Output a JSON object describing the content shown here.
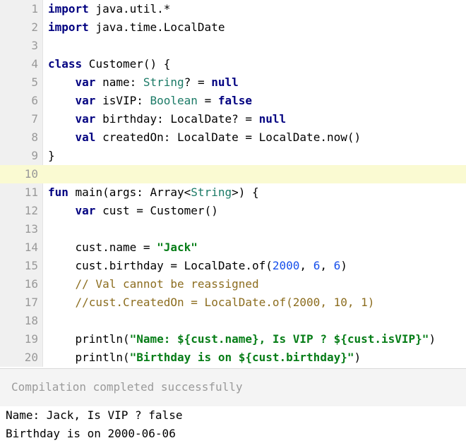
{
  "editor": {
    "lines": [
      {
        "num": "1",
        "tokens": [
          {
            "t": "import",
            "c": "kw"
          },
          {
            "t": " java.util.*",
            "c": ""
          }
        ]
      },
      {
        "num": "2",
        "tokens": [
          {
            "t": "import",
            "c": "kw"
          },
          {
            "t": " java.time.LocalDate",
            "c": ""
          }
        ]
      },
      {
        "num": "3",
        "tokens": []
      },
      {
        "num": "4",
        "tokens": [
          {
            "t": "class",
            "c": "kw"
          },
          {
            "t": " Customer() {",
            "c": ""
          }
        ]
      },
      {
        "num": "5",
        "tokens": [
          {
            "t": "    ",
            "c": ""
          },
          {
            "t": "var",
            "c": "kw"
          },
          {
            "t": " name: ",
            "c": ""
          },
          {
            "t": "String",
            "c": "ty"
          },
          {
            "t": "? = ",
            "c": ""
          },
          {
            "t": "null",
            "c": "kw"
          }
        ]
      },
      {
        "num": "6",
        "tokens": [
          {
            "t": "    ",
            "c": ""
          },
          {
            "t": "var",
            "c": "kw"
          },
          {
            "t": " isVIP: ",
            "c": ""
          },
          {
            "t": "Boolean",
            "c": "ty"
          },
          {
            "t": " = ",
            "c": ""
          },
          {
            "t": "false",
            "c": "kw"
          }
        ]
      },
      {
        "num": "7",
        "tokens": [
          {
            "t": "    ",
            "c": ""
          },
          {
            "t": "var",
            "c": "kw"
          },
          {
            "t": " birthday: LocalDate? = ",
            "c": ""
          },
          {
            "t": "null",
            "c": "kw"
          }
        ]
      },
      {
        "num": "8",
        "tokens": [
          {
            "t": "    ",
            "c": ""
          },
          {
            "t": "val",
            "c": "kw"
          },
          {
            "t": " createdOn: LocalDate = LocalDate.now()",
            "c": ""
          }
        ]
      },
      {
        "num": "9",
        "tokens": [
          {
            "t": "}",
            "c": ""
          }
        ]
      },
      {
        "num": "10",
        "tokens": [],
        "highlight": true
      },
      {
        "num": "11",
        "tokens": [
          {
            "t": "fun",
            "c": "kw"
          },
          {
            "t": " main(args: Array<",
            "c": ""
          },
          {
            "t": "String",
            "c": "ty"
          },
          {
            "t": ">) {",
            "c": ""
          }
        ]
      },
      {
        "num": "12",
        "tokens": [
          {
            "t": "    ",
            "c": ""
          },
          {
            "t": "var",
            "c": "kw"
          },
          {
            "t": " cust = Customer()",
            "c": ""
          }
        ]
      },
      {
        "num": "13",
        "tokens": []
      },
      {
        "num": "14",
        "tokens": [
          {
            "t": "    cust.name = ",
            "c": ""
          },
          {
            "t": "\"Jack\"",
            "c": "str"
          }
        ]
      },
      {
        "num": "15",
        "tokens": [
          {
            "t": "    cust.birthday = LocalDate.of(",
            "c": ""
          },
          {
            "t": "2000",
            "c": "num"
          },
          {
            "t": ", ",
            "c": ""
          },
          {
            "t": "6",
            "c": "num"
          },
          {
            "t": ", ",
            "c": ""
          },
          {
            "t": "6",
            "c": "num"
          },
          {
            "t": ")",
            "c": ""
          }
        ]
      },
      {
        "num": "16",
        "tokens": [
          {
            "t": "    ",
            "c": ""
          },
          {
            "t": "// Val cannot be reassigned",
            "c": "cm"
          }
        ]
      },
      {
        "num": "17",
        "tokens": [
          {
            "t": "    ",
            "c": ""
          },
          {
            "t": "//cust.CreatedOn = LocalDate.of(2000, 10, 1)",
            "c": "cm"
          }
        ]
      },
      {
        "num": "18",
        "tokens": []
      },
      {
        "num": "19",
        "tokens": [
          {
            "t": "    println(",
            "c": ""
          },
          {
            "t": "\"Name: ${cust.name}, Is VIP ? ${cust.isVIP}\"",
            "c": "str"
          },
          {
            "t": ")",
            "c": ""
          }
        ]
      },
      {
        "num": "20",
        "tokens": [
          {
            "t": "    println(",
            "c": ""
          },
          {
            "t": "\"Birthday is on ${cust.birthday}\"",
            "c": "str"
          },
          {
            "t": ")",
            "c": ""
          }
        ]
      }
    ]
  },
  "status": {
    "message": "Compilation completed successfully"
  },
  "output": {
    "lines": [
      "Name: Jack, Is VIP ? false",
      "Birthday is on 2000-06-06"
    ]
  },
  "colors": {
    "keyword": "#000080",
    "type": "#1b7a66",
    "string": "#067d17",
    "number": "#1750eb",
    "comment": "#8c6d1f",
    "current_line": "#fafad2"
  }
}
